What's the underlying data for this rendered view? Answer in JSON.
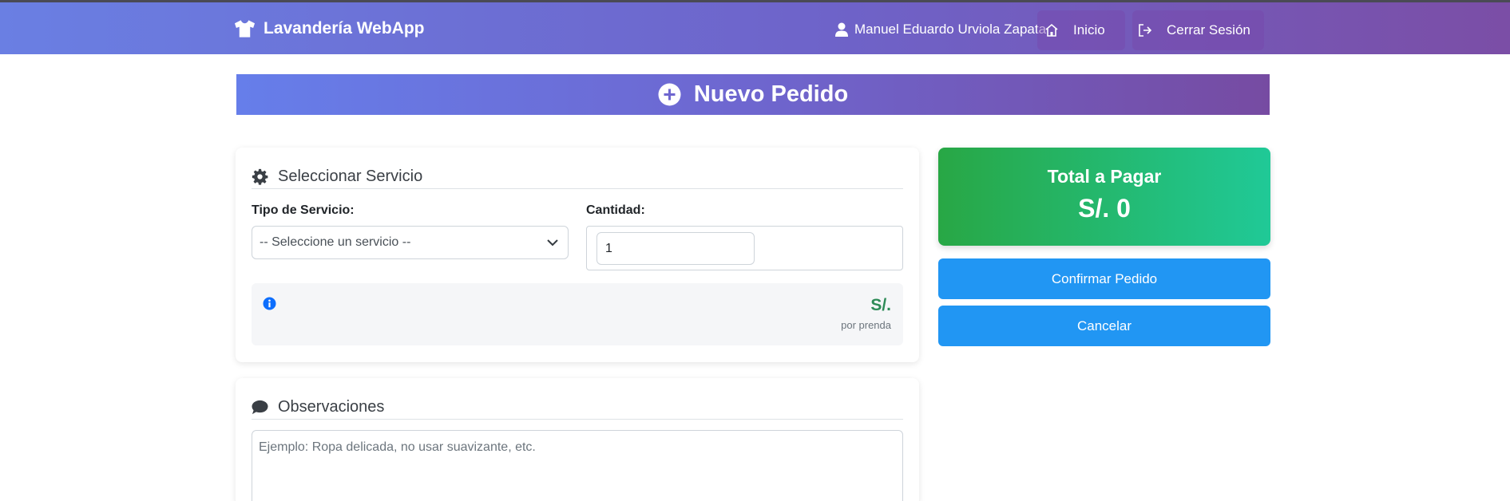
{
  "navbar": {
    "brand": "Lavandería WebApp",
    "user_name": "Manuel Eduardo Urviola Zapata",
    "home_label": "Inicio",
    "logout_label": "Cerrar Sesión"
  },
  "header": {
    "title": "Nuevo Pedido"
  },
  "service_card": {
    "title": "Seleccionar Servicio",
    "service_type_label": "Tipo de Servicio:",
    "service_select_value": "-- Seleccione un servicio --",
    "quantity_label": "Cantidad:",
    "quantity_value": "1",
    "price_text": "S/.",
    "price_unit": "por prenda"
  },
  "observations_card": {
    "title": "Observaciones",
    "placeholder": "Ejemplo: Ropa delicada, no usar suavizante, etc."
  },
  "summary": {
    "total_label": "Total a Pagar",
    "total_amount": "S/. 0",
    "confirm_label": "Confirmar Pedido",
    "cancel_label": "Cancelar"
  },
  "colors": {
    "header_gradient_start": "#667eea",
    "header_gradient_end": "#764ba2",
    "total_gradient_start": "#28a745",
    "total_gradient_end": "#20c997",
    "button_blue": "#2196f3",
    "price_green": "#2e8b57"
  },
  "icons": {
    "brand": "tshirt-icon",
    "user": "user-icon",
    "home": "home-icon",
    "logout": "sign-out-icon",
    "header": "plus-circle-icon",
    "service": "gear-icon",
    "info": "info-circle-icon",
    "observations": "comment-icon",
    "select": "chevron-down-icon"
  }
}
